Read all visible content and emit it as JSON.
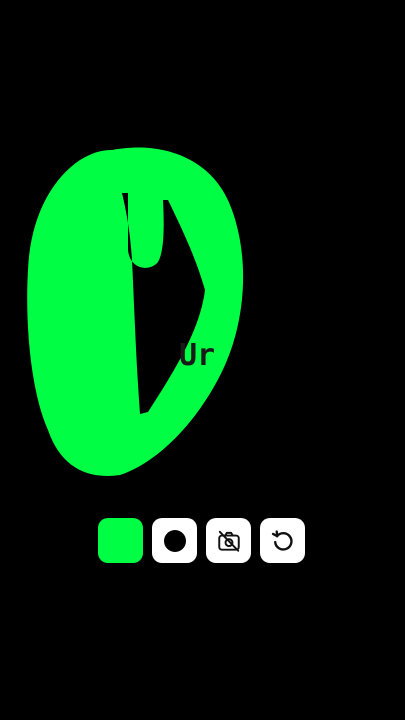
{
  "canvas": {
    "overlay_text": "Ur",
    "stroke_color": "#00FF44",
    "background_color": "#000000"
  },
  "toolbar": {
    "tools": [
      {
        "name": "color-swatch",
        "color": "#00FF44",
        "selected": true
      },
      {
        "name": "brush-size-icon"
      },
      {
        "name": "camera-off-icon"
      },
      {
        "name": "undo-icon"
      }
    ]
  }
}
